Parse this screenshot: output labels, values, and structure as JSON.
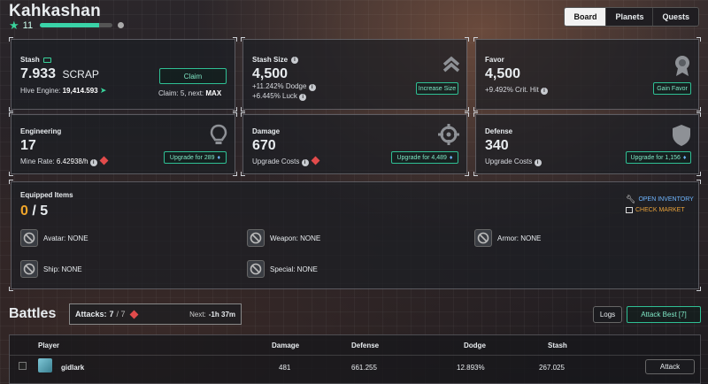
{
  "header": {
    "title": "Kahkashan",
    "level": "11",
    "xp_progress": 0.82
  },
  "tabs": [
    {
      "label": "Board",
      "active": true
    },
    {
      "label": "Planets",
      "active": false
    },
    {
      "label": "Quests",
      "active": false
    }
  ],
  "stash": {
    "label": "Stash",
    "amount": "7.933",
    "unit": "SCRAP",
    "hive_engine_label": "Hive Engine:",
    "hive_engine_value": "19,414.593",
    "claim_button": "Claim",
    "claim_prefix": "Claim:",
    "claim_value": "5",
    "next_prefix": ", next:",
    "next_value": "MAX"
  },
  "stash_size": {
    "label": "Stash Size",
    "value": "4,500",
    "dodge": "+11.242% Dodge",
    "luck": "+6.445% Luck",
    "button": "Increase Size"
  },
  "favor": {
    "label": "Favor",
    "value": "4,500",
    "crit": "+9.492% Crit. Hit",
    "button": "Gain Favor"
  },
  "engineering": {
    "label": "Engineering",
    "value": "17",
    "rate_label": "Mine Rate:",
    "rate_value": "6.42938/h",
    "button": "Upgrade for 289"
  },
  "damage": {
    "label": "Damage",
    "value": "670",
    "sub": "Upgrade Costs",
    "button": "Upgrade for 4,489"
  },
  "defense": {
    "label": "Defense",
    "value": "340",
    "sub": "Upgrade Costs",
    "button": "Upgrade for 1,156"
  },
  "equipped": {
    "label": "Equipped Items",
    "count": "0",
    "total": "/ 5",
    "open_inventory": "OPEN INVENTORY",
    "check_market": "CHECK MARKET",
    "slots": [
      {
        "label": "Avatar: NONE"
      },
      {
        "label": "Weapon: NONE"
      },
      {
        "label": "Armor: NONE"
      },
      {
        "label": "Ship: NONE"
      },
      {
        "label": "Special: NONE"
      }
    ]
  },
  "battles": {
    "title": "Battles",
    "attacks_label": "Attacks:",
    "attacks_value": "7",
    "attacks_total": "/ 7",
    "next_label": "Next:",
    "next_value": "-1h 37m",
    "logs_button": "Logs",
    "attack_best_button": "Attack Best [7]",
    "columns": [
      "Player",
      "Damage",
      "Defense",
      "Dodge",
      "Stash"
    ],
    "rows": [
      {
        "player": "gidlark",
        "damage": "481",
        "defense": "661.255",
        "dodge": "12.893%",
        "stash": "267.025",
        "action": "Attack"
      }
    ]
  },
  "colors": {
    "accent": "#2fbf94",
    "level_count": "#f0a52a",
    "warn": "#e24b4b",
    "link": "#6fb6ff",
    "market": "#e8a23a"
  }
}
